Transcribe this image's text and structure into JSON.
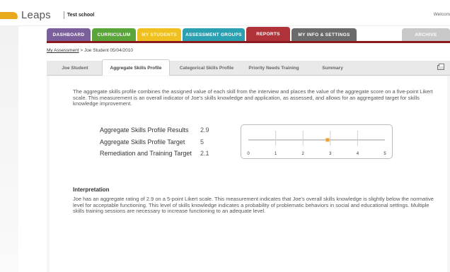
{
  "brand": {
    "name": "Leaps",
    "accent": "#e8a91c"
  },
  "header": {
    "school": "Test school",
    "welcome": "Welcom"
  },
  "nav": {
    "tabs": [
      {
        "label": "DASHBOARD",
        "color": "#7b5f9a"
      },
      {
        "label": "CURRICULUM",
        "color": "#5aa53a"
      },
      {
        "label": "MY STUDENTS",
        "color": "#f0c020"
      },
      {
        "label": "ASSESSMENT GROUPS",
        "color": "#2aa0b0"
      },
      {
        "label": "REPORTS",
        "color": "#b0333a",
        "active": true
      },
      {
        "label": "MY INFO & SETTINGS",
        "color": "#6b6b6b"
      },
      {
        "label": "ARCHIVE",
        "color": "#c8c8c8"
      }
    ]
  },
  "breadcrumb": {
    "link": "My Assessment",
    "separator": ">",
    "current": "Joe Student 05/04/2010"
  },
  "subtabs": [
    {
      "label": "Joe Student"
    },
    {
      "label": "Aggregate Skills Profile",
      "active": true
    },
    {
      "label": "Categorical Skills Profile"
    },
    {
      "label": "Priority Needs Training"
    },
    {
      "label": "Summary"
    }
  ],
  "print_icon": "printer-icon",
  "intro": "The aggregate skills profile combines the assigned value of each skill from the interview and places the value of the aggregate score on a five-point Likert scale.  This measurement is an overall indicator of Joe's skills knowledge and application, as assessed, and allows for an aggregated target for skills knowledge improvement.",
  "metrics": [
    {
      "label": "Aggregate Skills Profile Results",
      "value": "2.9"
    },
    {
      "label": "Aggregate Skills Profile Target",
      "value": "5"
    },
    {
      "label": "Remediation and Training Target",
      "value": "2.1"
    }
  ],
  "chart_data": {
    "type": "scatter",
    "x_ticks": [
      "0",
      "1",
      "2",
      "3",
      "4",
      "5"
    ],
    "xlim": [
      0,
      5
    ],
    "marker_value": 2.9,
    "marker_color": "#f0a030"
  },
  "interpretation": {
    "title": "Interpretation",
    "text": "Joe has an aggregate rating of 2.9 on a 5-point Likert scale.  This measurement indicates that Joe's overall skills knowledge is slightly below the normative level for acceptable functioning.  This level of skills knowledge indicates a probability of problematic behaviors in social and educational settings.  Multiple skills training sessions are necessary to increase functioning to an adequate level."
  }
}
